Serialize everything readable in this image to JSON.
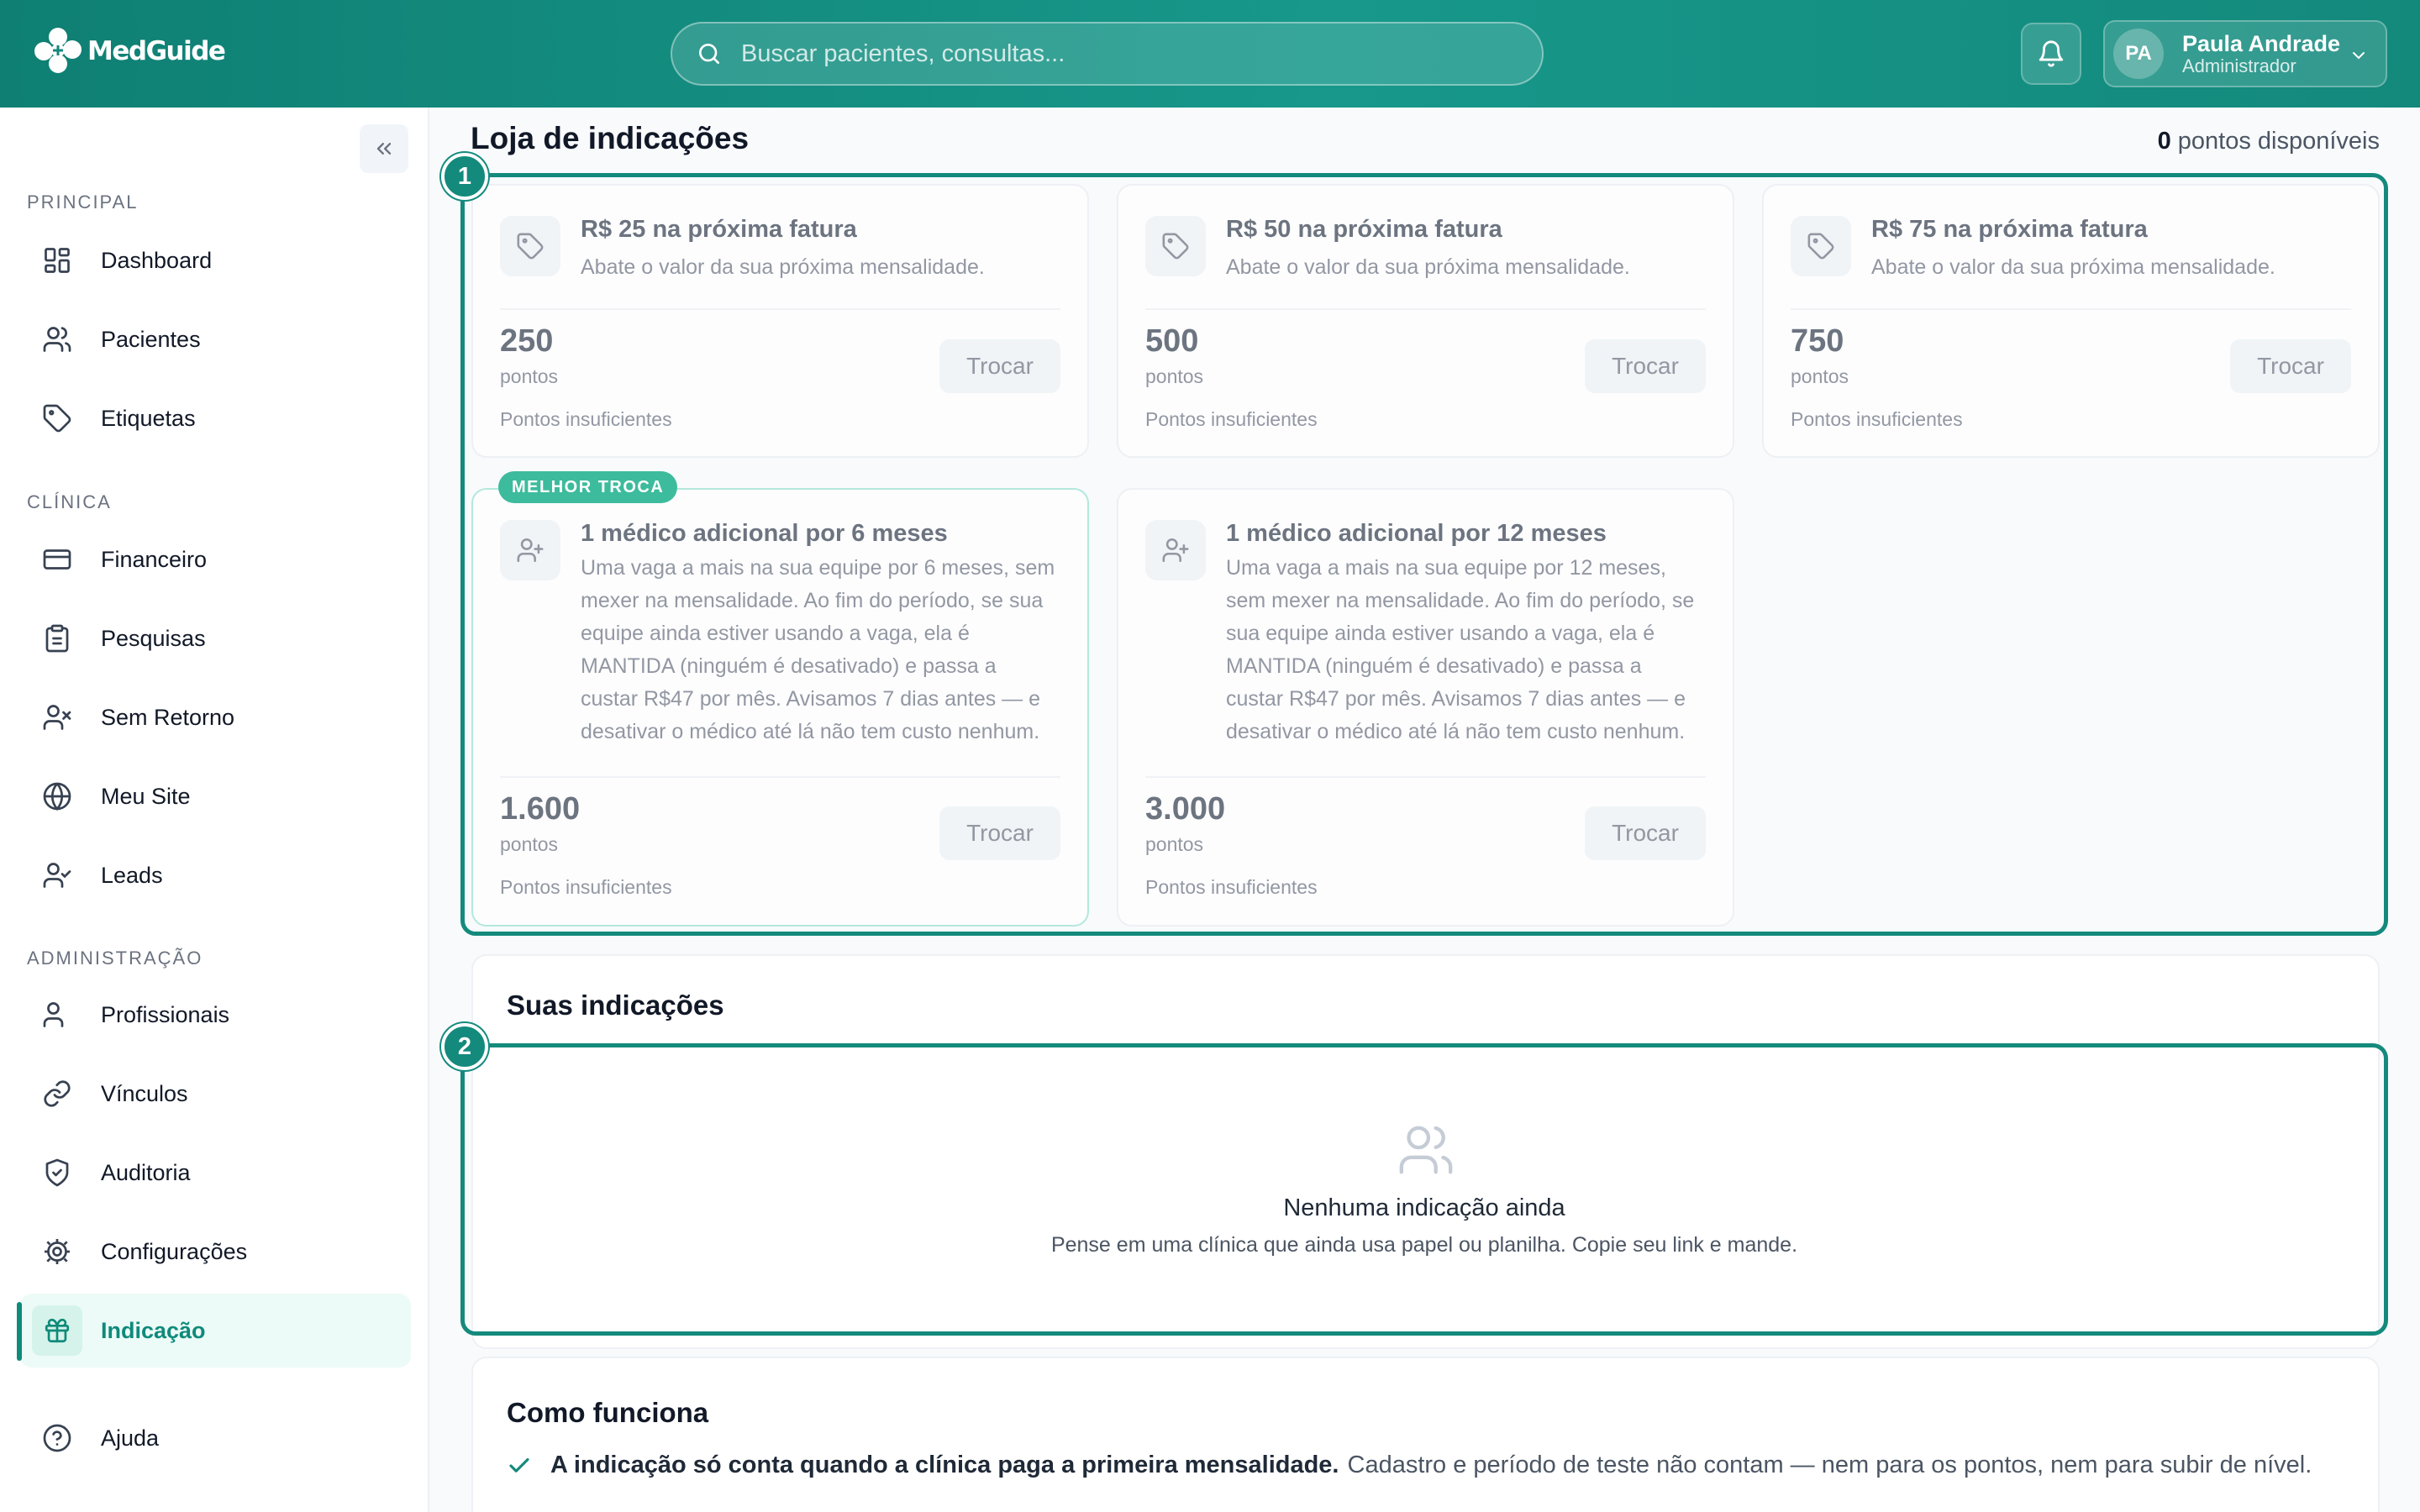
{
  "app": {
    "brand": "MedGuide"
  },
  "header": {
    "search_placeholder": "Buscar pacientes, consultas...",
    "user": {
      "initials": "PA",
      "name": "Paula Andrade",
      "role": "Administrador"
    }
  },
  "sidebar": {
    "sections": [
      {
        "title": "PRINCIPAL",
        "items": [
          {
            "label": "Dashboard",
            "icon": "grid-icon"
          },
          {
            "label": "Pacientes",
            "icon": "users-icon"
          },
          {
            "label": "Etiquetas",
            "icon": "tag-icon"
          }
        ]
      },
      {
        "title": "CLÍNICA",
        "items": [
          {
            "label": "Financeiro",
            "icon": "credit-card-icon"
          },
          {
            "label": "Pesquisas",
            "icon": "clipboard-icon"
          },
          {
            "label": "Sem Retorno",
            "icon": "user-x-icon"
          },
          {
            "label": "Meu Site",
            "icon": "globe-icon"
          },
          {
            "label": "Leads",
            "icon": "user-check-icon"
          }
        ]
      },
      {
        "title": "ADMINISTRAÇÃO",
        "items": [
          {
            "label": "Profissionais",
            "icon": "users-icon"
          },
          {
            "label": "Vínculos",
            "icon": "link-icon"
          },
          {
            "label": "Auditoria",
            "icon": "shield-icon"
          },
          {
            "label": "Configurações",
            "icon": "gear-icon"
          },
          {
            "label": "Indicação",
            "icon": "gift-icon",
            "active": true
          }
        ]
      }
    ],
    "help": {
      "label": "Ajuda",
      "icon": "help-circle-icon"
    }
  },
  "store": {
    "title": "Loja de indicações",
    "points_available": "0",
    "points_available_label": "pontos disponíveis",
    "callouts": [
      "1",
      "2"
    ],
    "best_badge": "MELHOR TROCA",
    "cards": [
      {
        "title": "R$ 25 na próxima fatura",
        "description": "Abate o valor da sua próxima mensalidade.",
        "points": "250",
        "unit": "pontos",
        "button": "Trocar",
        "note": "Pontos insuficientes",
        "icon": "tag-icon"
      },
      {
        "title": "R$ 50 na próxima fatura",
        "description": "Abate o valor da sua próxima mensalidade.",
        "points": "500",
        "unit": "pontos",
        "button": "Trocar",
        "note": "Pontos insuficientes",
        "icon": "tag-icon"
      },
      {
        "title": "R$ 75 na próxima fatura",
        "description": "Abate o valor da sua próxima mensalidade.",
        "points": "750",
        "unit": "pontos",
        "button": "Trocar",
        "note": "Pontos insuficientes",
        "icon": "tag-icon"
      },
      {
        "title": "1 médico adicional por 6 meses",
        "description_lines": [
          "Uma vaga a mais na sua equipe por 6 meses, sem",
          "mexer na mensalidade. Ao fim do período, se sua",
          "equipe ainda estiver usando a vaga, ela é",
          "MANTIDA (ninguém é desativado) e passa a",
          "custar R$47 por mês. Avisamos 7 dias antes — e",
          "desativar o médico até lá não tem custo nenhum."
        ],
        "points": "1.600",
        "unit": "pontos",
        "button": "Trocar",
        "note": "Pontos insuficientes",
        "icon": "user-plus-icon",
        "best": true
      },
      {
        "title": "1 médico adicional por 12 meses",
        "description_lines": [
          "Uma vaga a mais na sua equipe por 12 meses,",
          "sem mexer na mensalidade. Ao fim do período, se",
          "sua equipe ainda estiver usando a vaga, ela é",
          "MANTIDA (ninguém é desativado) e passa a",
          "custar R$47 por mês. Avisamos 7 dias antes — e",
          "desativar o médico até lá não tem custo nenhum."
        ],
        "points": "3.000",
        "unit": "pontos",
        "button": "Trocar",
        "note": "Pontos insuficientes",
        "icon": "user-plus-icon"
      }
    ]
  },
  "referrals": {
    "title": "Suas indicações",
    "empty_title": "Nenhuma indicação ainda",
    "empty_subtitle": "Pense em uma clínica que ainda usa papel ou planilha. Copie seu link e mande."
  },
  "how_it_works": {
    "title": "Como funciona",
    "items": [
      {
        "bold": "A indicação só conta quando a clínica paga a primeira mensalidade.",
        "text": "Cadastro e período de teste não contam — nem para os pontos, nem para subir de nível."
      }
    ]
  },
  "colors": {
    "primary": "#148a7d",
    "accent_light": "#ecfbf7",
    "badge": "#3dbb9d"
  }
}
